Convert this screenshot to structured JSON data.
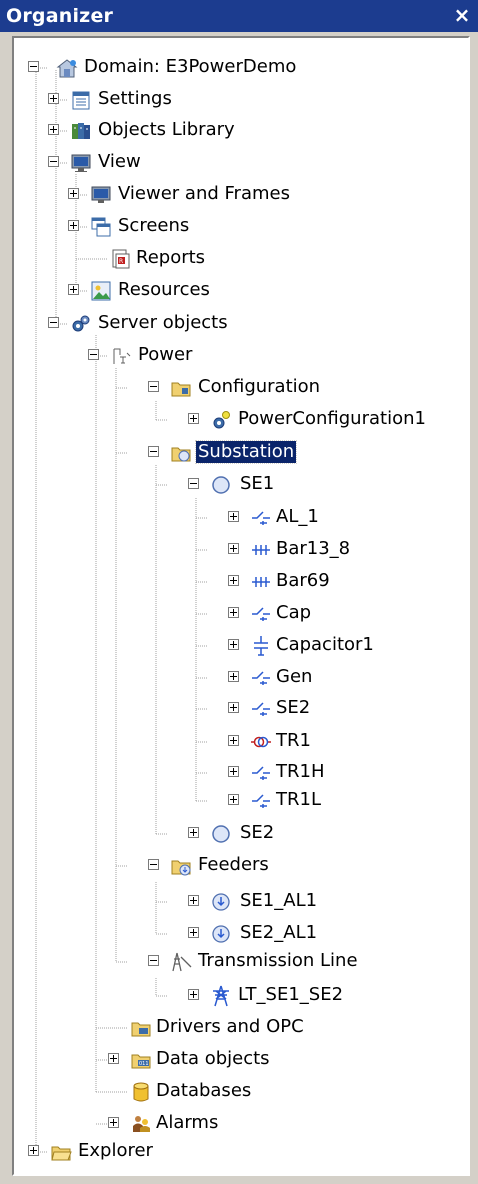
{
  "window": {
    "title": "Organizer",
    "close_glyph": "×"
  },
  "tree": {
    "domain": "Domain: E3PowerDemo",
    "settings": "Settings",
    "objects_library": "Objects Library",
    "view": "View",
    "viewer_frames": "Viewer and Frames",
    "screens": "Screens",
    "reports": "Reports",
    "resources": "Resources",
    "server_objects": "Server objects",
    "power": "Power",
    "configuration": "Configuration",
    "power_configuration": "PowerConfiguration1",
    "substation": "Substation",
    "se1": "SE1",
    "al_1": "AL_1",
    "bar13_8": "Bar13_8",
    "bar69": "Bar69",
    "cap": "Cap",
    "capacitor1": "Capacitor1",
    "gen": "Gen",
    "se2_child": "SE2",
    "tr1": "TR1",
    "tr1h": "TR1H",
    "tr1l": "TR1L",
    "se2": "SE2",
    "feeders": "Feeders",
    "se1_al1": "SE1_AL1",
    "se2_al1": "SE2_AL1",
    "transmission_line": "Transmission Line",
    "lt_se1_se2": "LT_SE1_SE2",
    "drivers_opc": "Drivers and OPC",
    "data_objects": "Data objects",
    "databases": "Databases",
    "alarms": "Alarms",
    "explorer": "Explorer"
  },
  "colors": {
    "selection": "#0a246a",
    "titlebar": "#1c3c8f",
    "tree_lines": "#a0a0a0"
  }
}
